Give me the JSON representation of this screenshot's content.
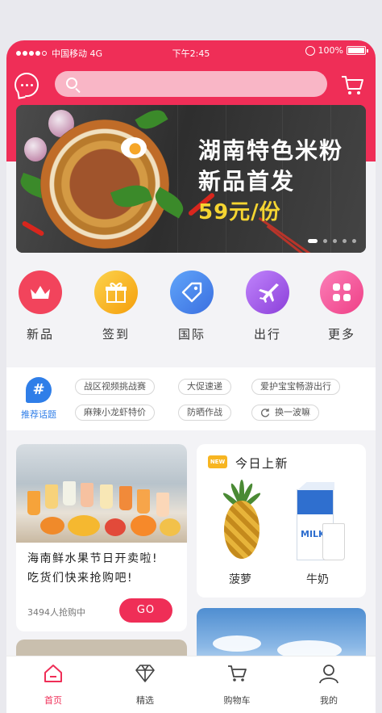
{
  "status_bar": {
    "carrier": "中国移动 4G",
    "time": "下午2:45",
    "battery": "100%",
    "signal_bars": 4
  },
  "header": {
    "search": {
      "placeholder": ""
    },
    "chat_icon": "chat-bubble-icon",
    "cart_icon": "shopping-cart-icon"
  },
  "banner": {
    "title_line1": "湖南特色米粉",
    "title_line2": "新品首发",
    "price": "59元/份",
    "slide_count": 5,
    "active_slide": 0
  },
  "categories": [
    {
      "label": "新品",
      "icon": "crown-icon",
      "color": "#f2445c"
    },
    {
      "label": "签到",
      "icon": "gift-icon",
      "color": "#f9b72c"
    },
    {
      "label": "国际",
      "icon": "tag-icon",
      "color": "#4a86ee"
    },
    {
      "label": "出行",
      "icon": "airplane-icon",
      "color": "#a24de0"
    },
    {
      "label": "更多",
      "icon": "grid-icon",
      "color": "#f24f93"
    }
  ],
  "topics": {
    "label": "推荐话题",
    "icon": "hashtag-icon",
    "tags": [
      "战区视频挑战赛",
      "大促速递",
      "爱护宝宝畅游出行",
      "麻辣小龙虾特价",
      "防晒作战",
      "换一波嘛"
    ]
  },
  "promo_card": {
    "title_line1": "海南鲜水果节日开卖啦!",
    "title_line2": "吃货们快来抢购吧!",
    "meta": "3494人抢购中",
    "button": "GO"
  },
  "new_today": {
    "badge": "NEW",
    "title": "今日上新",
    "products": [
      {
        "label": "菠萝"
      },
      {
        "label": "牛奶",
        "package_text": "MILK"
      }
    ]
  },
  "tabbar": [
    {
      "label": "首页",
      "icon": "home-icon",
      "active": true
    },
    {
      "label": "精选",
      "icon": "diamond-icon",
      "active": false
    },
    {
      "label": "购物车",
      "icon": "cart-icon",
      "active": false
    },
    {
      "label": "我的",
      "icon": "user-icon",
      "active": false
    }
  ],
  "colors": {
    "accent": "#ef2e57",
    "topic_blue": "#2f7ee8",
    "price_yellow": "#f5d531"
  }
}
